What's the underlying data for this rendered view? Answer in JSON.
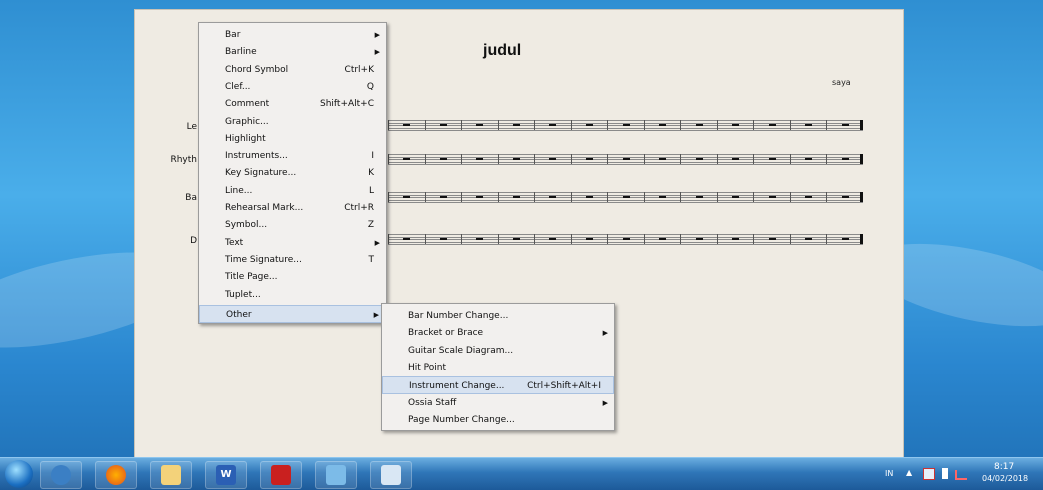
{
  "score": {
    "title": "judul",
    "composer": "saya",
    "instruments": [
      "Le",
      "Rhyth",
      "Ba",
      "D"
    ]
  },
  "context_menu": {
    "items": [
      {
        "label": "Bar",
        "shortcut": "",
        "submenu": true
      },
      {
        "label": "Barline",
        "shortcut": "",
        "submenu": true
      },
      {
        "label": "Chord Symbol",
        "shortcut": "Ctrl+K",
        "submenu": false
      },
      {
        "label": "Clef...",
        "shortcut": "Q",
        "submenu": false
      },
      {
        "label": "Comment",
        "shortcut": "Shift+Alt+C",
        "submenu": false
      },
      {
        "label": "Graphic...",
        "shortcut": "",
        "submenu": false
      },
      {
        "label": "Highlight",
        "shortcut": "",
        "submenu": false
      },
      {
        "label": "Instruments...",
        "shortcut": "I",
        "submenu": false
      },
      {
        "label": "Key Signature...",
        "shortcut": "K",
        "submenu": false
      },
      {
        "label": "Line...",
        "shortcut": "L",
        "submenu": false
      },
      {
        "label": "Rehearsal Mark...",
        "shortcut": "Ctrl+R",
        "submenu": false
      },
      {
        "label": "Symbol...",
        "shortcut": "Z",
        "submenu": false
      },
      {
        "label": "Text",
        "shortcut": "",
        "submenu": true
      },
      {
        "label": "Time Signature...",
        "shortcut": "T",
        "submenu": false
      },
      {
        "label": "Title Page...",
        "shortcut": "",
        "submenu": false
      },
      {
        "label": "Tuplet...",
        "shortcut": "",
        "submenu": false
      }
    ],
    "other_label": "Other"
  },
  "submenu": {
    "items": [
      {
        "label": "Bar Number Change...",
        "shortcut": "",
        "submenu": false
      },
      {
        "label": "Bracket or Brace",
        "shortcut": "",
        "submenu": true
      },
      {
        "label": "Guitar Scale Diagram...",
        "shortcut": "",
        "submenu": false
      },
      {
        "label": "Hit Point",
        "shortcut": "",
        "submenu": false
      },
      {
        "label": "Instrument Change...",
        "shortcut": "Ctrl+Shift+Alt+I",
        "submenu": false
      },
      {
        "label": "Ossia Staff",
        "shortcut": "",
        "submenu": true
      },
      {
        "label": "Page Number Change...",
        "shortcut": "",
        "submenu": false
      }
    ],
    "highlighted_index": 4
  },
  "taskbar": {
    "apps": [
      "start-orb",
      "media-player",
      "firefox",
      "file-explorer",
      "word",
      "acrobat",
      "web-app",
      "paint"
    ],
    "language": "IN",
    "time": "8:17",
    "date": "04/02/2018"
  },
  "colors": {
    "menu_highlight": "#d7e2f0",
    "paper": "#efebe3",
    "taskbar": "#2f76b8"
  }
}
